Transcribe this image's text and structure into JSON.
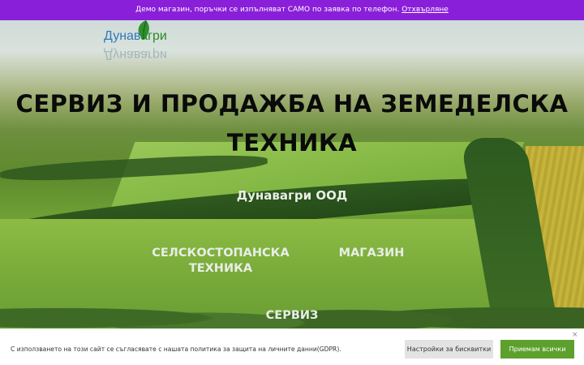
{
  "banner": {
    "text": "Демо магазин, поръчки се изпълняват САМО по заявка по телефон.",
    "dismiss_link": "Отхвърляне"
  },
  "logo": {
    "part1": "Дунав",
    "part2": "агри",
    "reflection": "Дунавагри"
  },
  "hero": {
    "title_line1": "СЕРВИЗ И ПРОДАЖБА НА ЗЕМЕДЕЛСКА",
    "title_line2": "ТЕХНИКА",
    "company": "Дунавагри  ООД"
  },
  "nav": {
    "machinery_line1": "СЕЛСКОСТОПАНСКА",
    "machinery_line2": "ТЕХНИКА",
    "shop": "МАГАЗИН",
    "service": "СЕРВИЗ"
  },
  "cookie": {
    "text": "С използването на този сайт се съгласявате с нашата политика за защита на личните данни(GDPR).",
    "settings_button": "Настройки за бисквитки",
    "accept_button": "Приемам всички",
    "close_glyph": "×"
  },
  "colors": {
    "banner_bg": "#8a1fd9",
    "accept_bg": "#5da02d",
    "settings_bg": "#e3e3e3"
  }
}
